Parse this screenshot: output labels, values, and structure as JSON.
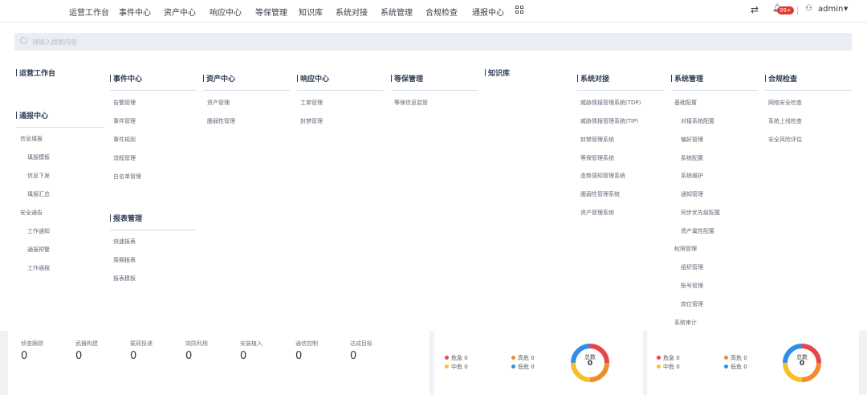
{
  "top_nav": {
    "items": [
      "运营工作台",
      "事件中心",
      "资产中心",
      "响应中心",
      "等保管理",
      "知识库",
      "系统对接",
      "系统管理",
      "合规检查",
      "通报中心"
    ],
    "apps_icon": "grid-icon",
    "notifications_badge": "99+",
    "user": "admin"
  },
  "search": {
    "placeholder": "请输入搜索内容"
  },
  "menu": {
    "ops": {
      "title": "运营工作台"
    },
    "report_center": {
      "title": "通报中心",
      "items": [
        "信息填报",
        "填报模板",
        "信息下发",
        "填报汇总",
        "安全通告",
        "工作通知",
        "通报预警",
        "工作通报"
      ]
    },
    "event_center": {
      "title": "事件中心",
      "items": [
        "告警管理",
        "事件管理",
        "事件规则",
        "流程管理",
        "白名单管理"
      ]
    },
    "report_mgmt": {
      "title": "报表管理",
      "items": [
        "快速报表",
        "周期报表",
        "报表模板"
      ]
    },
    "asset_center": {
      "title": "资产中心",
      "items": [
        "资产管理",
        "脆弱性管理"
      ]
    },
    "response_center": {
      "title": "响应中心",
      "items": [
        "工单管理",
        "封禁管理"
      ]
    },
    "dengbao": {
      "title": "等保管理",
      "items": [
        "等保信息监管"
      ]
    },
    "knowledge": {
      "title": "知识库"
    },
    "system_integration": {
      "title": "系统对接",
      "items": [
        "威胁情报管理系统(TDP)",
        "威胁情报管理系统(TIP)",
        "封禁管理系统",
        "等保管理系统",
        "态势感知管理系统",
        "脆弱性管理系统",
        "资产管理系统"
      ]
    },
    "system_mgmt": {
      "title": "系统管理",
      "items": [
        "基础配置",
        "对接系统配置",
        "偏好管理",
        "系统配置",
        "系统维护",
        "通知管理",
        "同步优先级配置",
        "资产属性配置",
        "权限管理",
        "组织管理",
        "账号管理",
        "岗位管理",
        "系统审计"
      ]
    },
    "compliance": {
      "title": "合规检查",
      "items": [
        "网络安全检查",
        "系统上线检查",
        "安全风险评估"
      ]
    }
  },
  "stats": [
    {
      "label": "侦查跟踪",
      "value": "0"
    },
    {
      "label": "武器构建",
      "value": "0"
    },
    {
      "label": "载荷投递",
      "value": "0"
    },
    {
      "label": "突防利用",
      "value": "0"
    },
    {
      "label": "安装植入",
      "value": "0"
    },
    {
      "label": "通信控制",
      "value": "0"
    },
    {
      "label": "达成目标",
      "value": "0"
    }
  ],
  "severity_panels": [
    {
      "legend": [
        {
          "label": "危急 0",
          "color": "#e8474a"
        },
        {
          "label": "高危 0",
          "color": "#f28b2c"
        },
        {
          "label": "中危 0",
          "color": "#f5c023"
        },
        {
          "label": "低危 0",
          "color": "#2f8de4"
        }
      ],
      "center_label": "总数",
      "center_value": "0"
    },
    {
      "legend": [
        {
          "label": "危急 0",
          "color": "#e8474a"
        },
        {
          "label": "高危 0",
          "color": "#f28b2c"
        },
        {
          "label": "中危 0",
          "color": "#f5c023"
        },
        {
          "label": "低危 0",
          "color": "#2f8de4"
        }
      ],
      "center_label": "总数",
      "center_value": "0"
    }
  ]
}
